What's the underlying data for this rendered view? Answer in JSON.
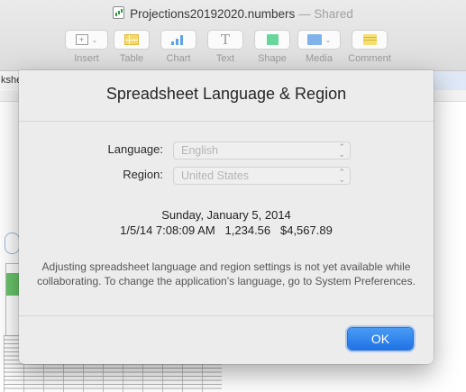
{
  "window": {
    "title": "Projections20192020.numbers",
    "title_separator": "—",
    "title_status": "Shared"
  },
  "toolbar": {
    "items": [
      {
        "label": "Insert",
        "icon": "insert-icon"
      },
      {
        "label": "Table",
        "icon": "table-icon"
      },
      {
        "label": "Chart",
        "icon": "chart-icon"
      },
      {
        "label": "Text",
        "icon": "text-icon"
      },
      {
        "label": "Shape",
        "icon": "shape-icon"
      },
      {
        "label": "Media",
        "icon": "media-icon"
      },
      {
        "label": "Comment",
        "icon": "comment-icon"
      }
    ],
    "text_glyph": "T"
  },
  "sheet": {
    "tab_label": "kshe"
  },
  "dialog": {
    "title": "Spreadsheet Language & Region",
    "language": {
      "label": "Language:",
      "value": "English"
    },
    "region": {
      "label": "Region:",
      "value": "United States"
    },
    "preview": {
      "date": "Sunday, January 5, 2014",
      "datetime": "1/5/14 7:08:09 AM",
      "number": "1,234.56",
      "currency": "$4,567.89"
    },
    "notice": "Adjusting spreadsheet language and region settings is not yet available while collaborating. To change the application’s language, go to System Preferences.",
    "ok_label": "OK"
  },
  "colors": {
    "accent": "#1f73e4",
    "table_icon": "#f6d76a",
    "chart_icon": "#5fa2e6",
    "shape_icon": "#67d69b",
    "comment_icon": "#f7de70"
  }
}
